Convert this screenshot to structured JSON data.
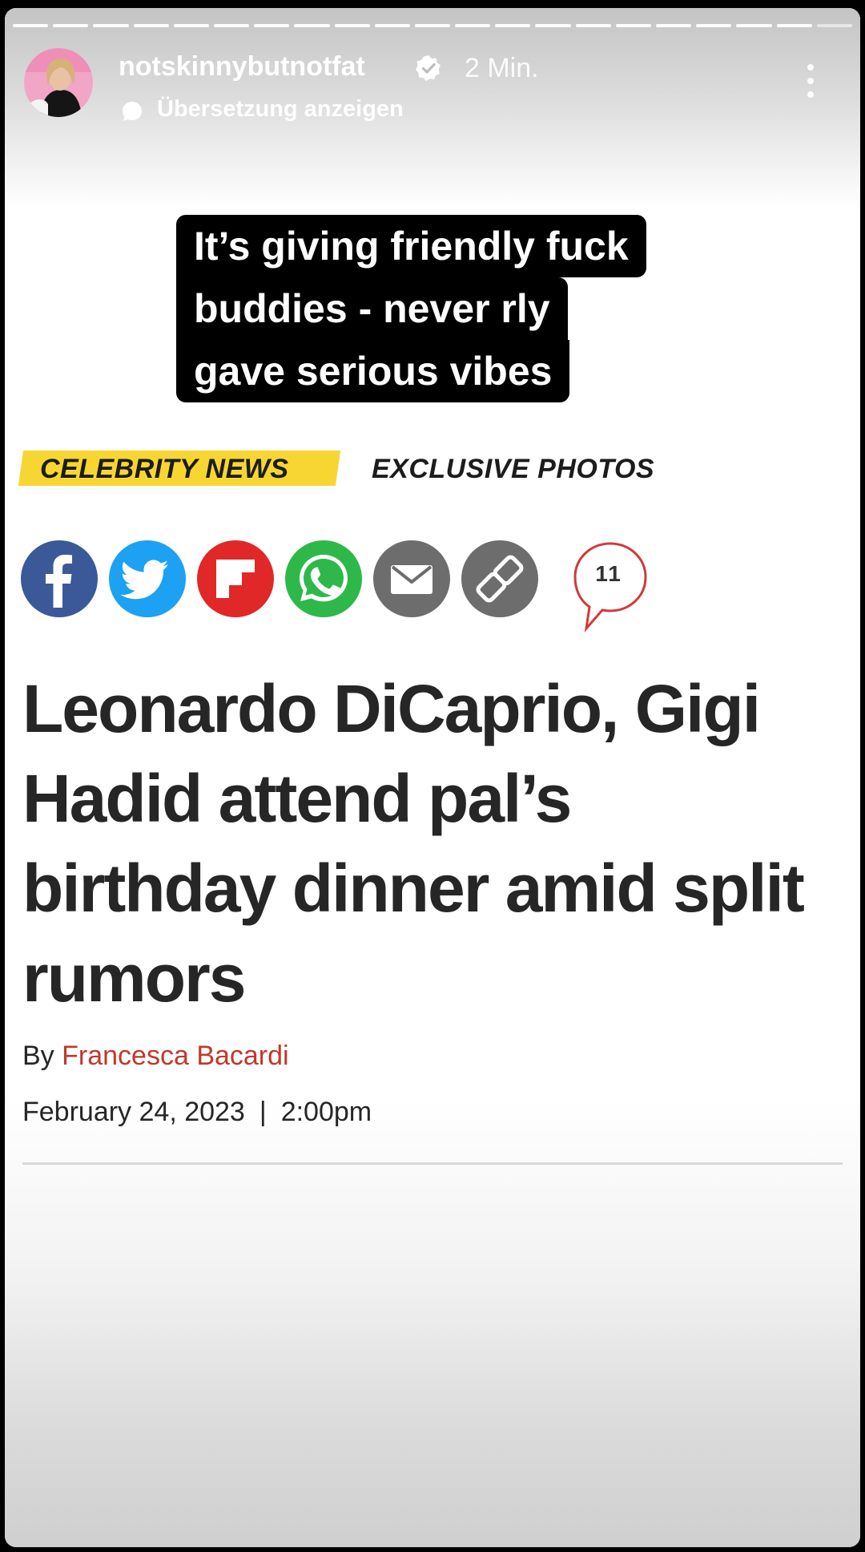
{
  "story": {
    "username": "notskinnybutnotfat",
    "time_ago": "2 Min.",
    "translate_label": "Übersetzung anzeigen",
    "progress_segments": 21,
    "progress_done": 20
  },
  "caption": {
    "lines": [
      "It’s giving friendly fuck",
      "buddies - never rly",
      "gave serious vibes"
    ]
  },
  "article": {
    "tags": {
      "primary": "CELEBRITY NEWS",
      "secondary": "EXCLUSIVE PHOTOS"
    },
    "share_icons": [
      "facebook-icon",
      "twitter-icon",
      "flipboard-icon",
      "whatsapp-icon",
      "email-icon",
      "link-icon"
    ],
    "comment_count": "11",
    "headline_lines": [
      "Leonardo DiCaprio, Gigi",
      "Hadid attend pal’s",
      "birthday dinner amid split",
      "rumors"
    ],
    "byline_prefix": "By",
    "author": "Francesca Bacardi",
    "date": "February 24, 2023",
    "date_separator": "|",
    "time": "2:00pm"
  },
  "colors": {
    "tag_yellow": "#f7d632",
    "facebook": "#3b5998",
    "twitter": "#1da1f2",
    "flipboard": "#e12828",
    "whatsapp": "#2fb84a",
    "email": "#6d6d6d",
    "link": "#6d6d6d",
    "author_red": "#c0392b"
  }
}
